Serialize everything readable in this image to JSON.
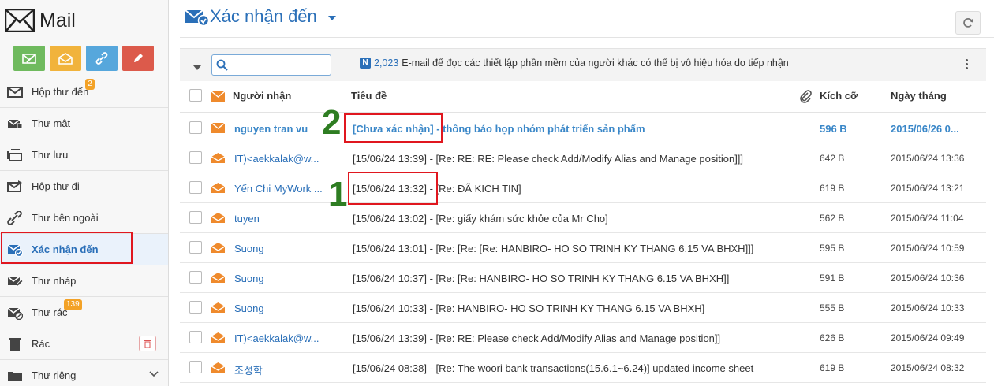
{
  "app": {
    "name": "Mail"
  },
  "quick_actions": [
    "write-mail",
    "read-mail",
    "link",
    "edit"
  ],
  "sidebar": {
    "items": [
      {
        "label": "Hộp thư đến",
        "icon": "inbox-icon",
        "badge": "2"
      },
      {
        "label": "Thư mật",
        "icon": "secure-mail-icon"
      },
      {
        "label": "Thư lưu",
        "icon": "archive-icon"
      },
      {
        "label": "Hộp thư đi",
        "icon": "sent-icon"
      },
      {
        "label": "Thư bên ngoài",
        "icon": "external-mail-icon"
      },
      {
        "label": "Xác nhận đến",
        "icon": "confirm-mail-icon",
        "active": true
      },
      {
        "label": "Thư nháp",
        "icon": "draft-icon"
      },
      {
        "label": "Thư rác",
        "icon": "spam-icon",
        "badge": "139"
      },
      {
        "label": "Rác",
        "icon": "trash-icon"
      },
      {
        "label": "Thư riêng",
        "icon": "private-folder-icon"
      }
    ]
  },
  "header": {
    "title": "Xác nhận đến"
  },
  "toolbar": {
    "search_placeholder": "",
    "notice_badge": "N",
    "notice_count": "2,023",
    "notice_text": "E-mail để đọc các thiết lập phần mềm của người khác có thể bị vô hiệu hóa do tiếp nhận"
  },
  "table": {
    "columns": {
      "recipient": "Người nhận",
      "subject": "Tiêu đề",
      "size": "Kích cỡ",
      "date": "Ngày tháng"
    },
    "rows": [
      {
        "sender": "nguyen tran vu",
        "tag": "[Chưa xác nhận]",
        "subject": " - thông báo họp nhóm phát triển sản phẩm",
        "size": "596 B",
        "date": "2015/06/26 0...",
        "unread": true
      },
      {
        "sender": "IT)<aekkalak@w...",
        "tag": "[15/06/24 13:39]",
        "subject": " - [Re: RE: RE: Please check Add/Modify Alias and Manage position]]]",
        "size": "642 B",
        "date": "2015/06/24 13:36"
      },
      {
        "sender": "Yến Chi MyWork ...",
        "tag": "[15/06/24 13:32]",
        "subject": " - [Re: ĐÃ KICH TIN]",
        "size": "619 B",
        "date": "2015/06/24 13:21"
      },
      {
        "sender": "tuyen",
        "tag": "[15/06/24 13:02]",
        "subject": " - [Re: giấy khám sức khỏe của Mr Cho]",
        "size": "562 B",
        "date": "2015/06/24 11:04"
      },
      {
        "sender": "Suong",
        "tag": "[15/06/24 13:01]",
        "subject": " - [Re: [Re: [Re: HANBIRO- HO SO TRINH KY THANG 6.15 VA BHXH]]]",
        "size": "595 B",
        "date": "2015/06/24 10:59"
      },
      {
        "sender": "Suong",
        "tag": "[15/06/24 10:37]",
        "subject": " - [Re: [Re: HANBIRO- HO SO TRINH KY THANG 6.15 VA BHXH]]",
        "size": "591 B",
        "date": "2015/06/24 10:36"
      },
      {
        "sender": "Suong",
        "tag": "[15/06/24 10:33]",
        "subject": " - [Re: HANBIRO- HO SO TRINH KY THANG 6.15 VA BHXH]",
        "size": "555 B",
        "date": "2015/06/24 10:33"
      },
      {
        "sender": "IT)<aekkalak@w...",
        "tag": "[15/06/24 13:39]",
        "subject": " - [Re: RE: Please check Add/Modify Alias and Manage position]]",
        "size": "626 B",
        "date": "2015/06/24 09:49"
      },
      {
        "sender": "조성학",
        "tag": "[15/06/24 08:38]",
        "subject": " - [Re: The woori bank transactions(15.6.1~6.24)] updated income sheet",
        "size": "619 B",
        "date": "2015/06/24 08:32"
      }
    ]
  },
  "annotations": {
    "num1": "1",
    "num2": "2"
  },
  "colors": {
    "accent": "#2a6fb8",
    "unread": "#3a87c8",
    "badge": "#f3a227",
    "highlight_box": "#e0171f",
    "annotation_number": "#2e7d22"
  }
}
